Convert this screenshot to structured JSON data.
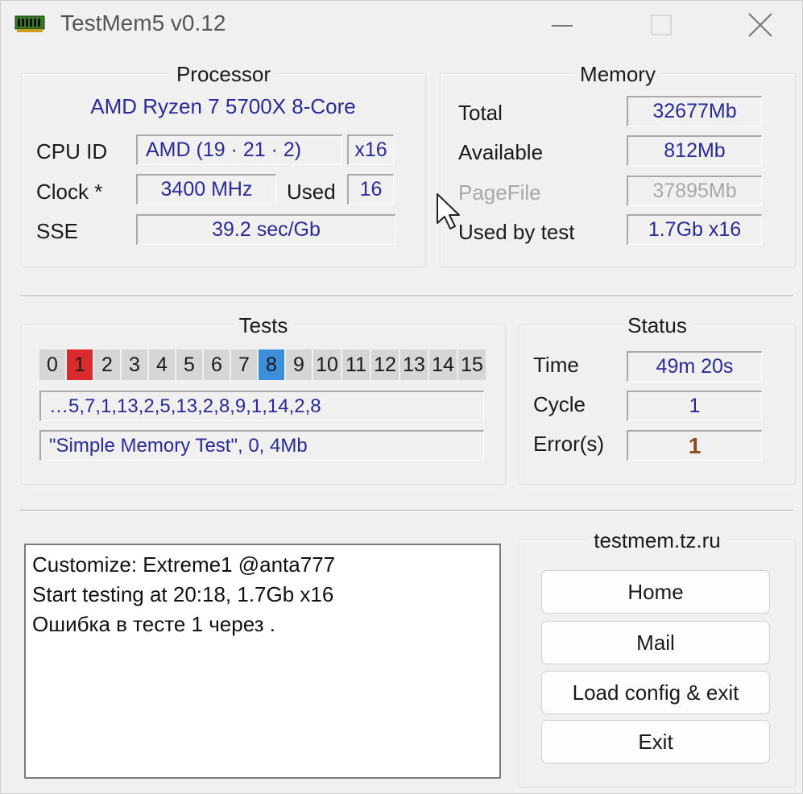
{
  "window": {
    "title": "TestMem5 v0.12"
  },
  "processor": {
    "group_title": "Processor",
    "cpu_name": "AMD Ryzen 7 5700X 8-Core",
    "cpu_id_label": "CPU ID",
    "cpu_id_value": "AMD  (19 · 21 · 2)",
    "threads_value": "x16",
    "clock_label": "Clock *",
    "clock_value": "3400 MHz",
    "used_label": "Used",
    "used_value": "16",
    "sse_label": "SSE",
    "sse_value": "39.2 sec/Gb"
  },
  "memory": {
    "group_title": "Memory",
    "total_label": "Total",
    "total_value": "32677Mb",
    "available_label": "Available",
    "available_value": "812Mb",
    "pagefile_label": "PageFile",
    "pagefile_value": "37895Mb",
    "used_by_test_label": "Used by test",
    "used_by_test_value": "1.7Gb x16"
  },
  "tests": {
    "group_title": "Tests",
    "cells": [
      "0",
      "1",
      "2",
      "3",
      "4",
      "5",
      "6",
      "7",
      "8",
      "9",
      "10",
      "11",
      "12",
      "13",
      "14",
      "15"
    ],
    "error_cell": "1",
    "current_cell": "8",
    "sequence": "…5,7,1,13,2,5,13,2,8,9,1,14,2,8",
    "current_test": "\"Simple Memory Test\", 0, 4Mb"
  },
  "status": {
    "group_title": "Status",
    "time_label": "Time",
    "time_value": "49m 20s",
    "cycle_label": "Cycle",
    "cycle_value": "1",
    "errors_label": "Error(s)",
    "errors_value": "1"
  },
  "log": {
    "lines": [
      "Customize: Extreme1 @anta777",
      "Start testing at 20:18, 1.7Gb x16",
      "Ошибка в тесте 1 через ."
    ]
  },
  "links": {
    "group_title": "testmem.tz.ru",
    "home": "Home",
    "mail": "Mail",
    "load_config": "Load config & exit",
    "exit": "Exit"
  },
  "colors": {
    "value_text": "#2a2a9a",
    "error_cell": "#d92b2b",
    "current_cell": "#3c8fd9",
    "error_count": "#8a4a1a"
  }
}
